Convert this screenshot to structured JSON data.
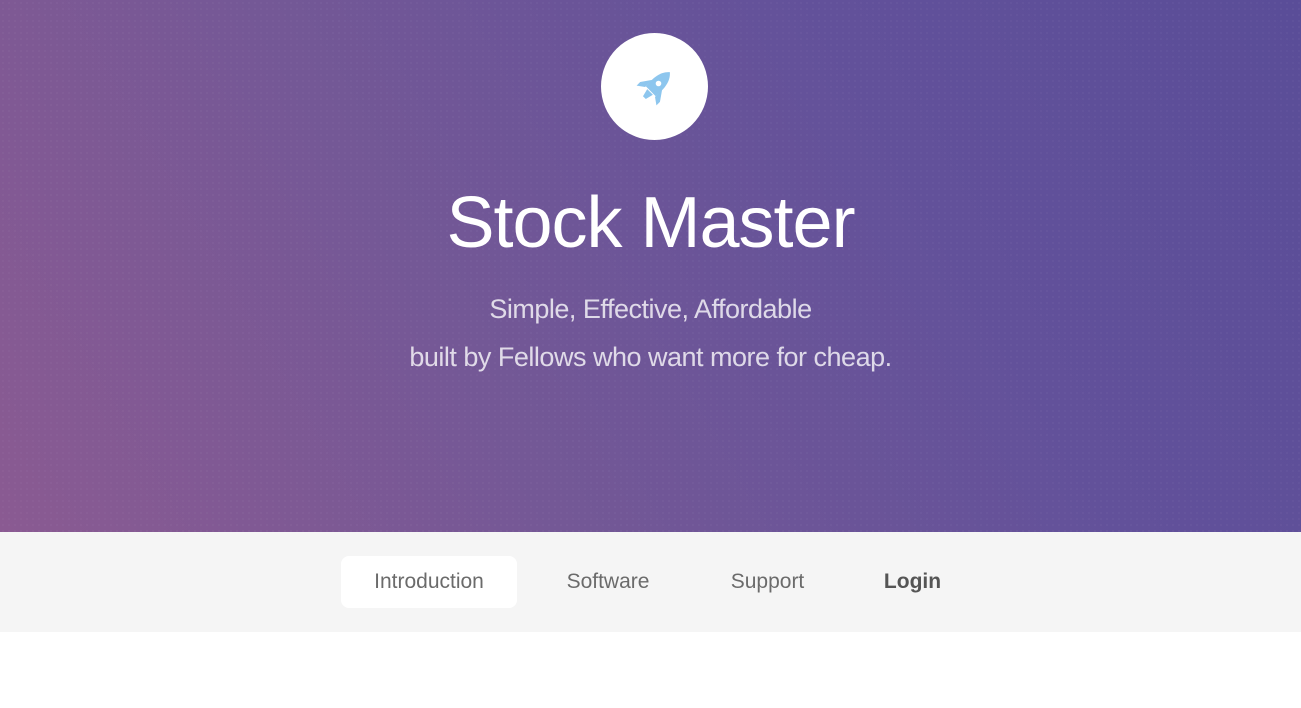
{
  "hero": {
    "title": "Stock Master",
    "tagline_line1": "Simple, Effective, Affordable",
    "tagline_line2": "built by Fellows who want more for cheap.",
    "logo_icon": "rocket-icon",
    "logo_color": "#8dc6ee"
  },
  "nav": {
    "items": [
      {
        "label": "Introduction",
        "active": true
      },
      {
        "label": "Software",
        "active": false
      },
      {
        "label": "Support",
        "active": false
      },
      {
        "label": "Login",
        "active": false
      }
    ]
  },
  "colors": {
    "hero_gradient_start": "#8a5a92",
    "hero_gradient_end": "#5a4d98",
    "nav_background": "#f5f5f5"
  }
}
